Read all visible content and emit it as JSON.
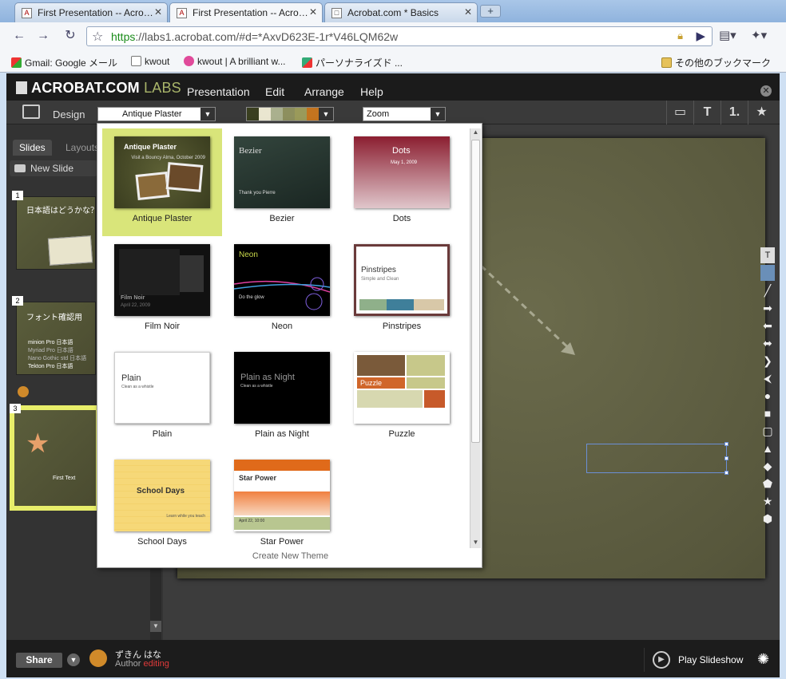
{
  "browser": {
    "tabs": [
      {
        "title": "First Presentation -- Acro…"
      },
      {
        "title": "First Presentation -- Acro…"
      },
      {
        "title": "Acrobat.com * Basics"
      }
    ],
    "url_scheme": "https",
    "url_rest": "://labs1.acrobat.com/#d=*AxvD623E-1r*V46LQM62w",
    "bookmarks": [
      {
        "label": "Gmail: Google メール"
      },
      {
        "label": "kwout"
      },
      {
        "label": "kwout | A brilliant w..."
      },
      {
        "label": "パーソナライズド ..."
      },
      {
        "label": "その他のブックマーク"
      }
    ]
  },
  "app": {
    "logo_main": "ACROBAT.COM",
    "logo_labs": "LABS",
    "menu": [
      "Presentation",
      "Edit",
      "Arrange",
      "Help"
    ],
    "design_label": "Design",
    "theme_select": "Antique Plaster",
    "zoom_select": "Zoom",
    "palette_colors": [
      "#3a3f20",
      "#eae6d0",
      "#aab08e",
      "#8d8f5e",
      "#9a9a5a",
      "#c3741f"
    ],
    "tools": [
      "T",
      "1."
    ]
  },
  "leftpanel": {
    "tabs": [
      "Slides",
      "Layouts"
    ],
    "new_slide": "New Slide",
    "slides": [
      {
        "num": "1",
        "title": "日本語はどうかな？"
      },
      {
        "num": "2",
        "title": "フォント確認用",
        "lines": [
          "minion Pro 日本語",
          "Myriad Pro 日本語",
          "Nano Gothic std 日本語",
          "Tekton Pro 日本語"
        ]
      },
      {
        "num": "3",
        "title": "First Text"
      }
    ]
  },
  "theme_panel": {
    "themes": [
      {
        "name": "Antique Plaster",
        "thumb_title": "Antique Plaster",
        "thumb_sub": "Visit a Bouncy Alma, October 2009"
      },
      {
        "name": "Bezier",
        "thumb_title": "Bezier",
        "thumb_sub": "Thank you Pierre"
      },
      {
        "name": "Dots",
        "thumb_title": "Dots",
        "thumb_sub": "May 1, 2009"
      },
      {
        "name": "Film Noir",
        "thumb_title": "Film Noir",
        "thumb_sub": "April 22, 2009"
      },
      {
        "name": "Neon",
        "thumb_title": "Neon",
        "thumb_sub": "Do the glow"
      },
      {
        "name": "Pinstripes",
        "thumb_title": "Pinstripes",
        "thumb_sub": "Simple and Clean"
      },
      {
        "name": "Plain",
        "thumb_title": "Plain",
        "thumb_sub": "Clean as a whistle"
      },
      {
        "name": "Plain as Night",
        "thumb_title": "Plain as Night",
        "thumb_sub": "Clean as a whistle"
      },
      {
        "name": "Puzzle",
        "thumb_title": "Puzzle",
        "thumb_sub": ""
      },
      {
        "name": "School Days",
        "thumb_title": "School Days",
        "thumb_sub": "Learn while you teach"
      },
      {
        "name": "Star Power",
        "thumb_title": "Star Power",
        "thumb_sub": "April 22, 10:00"
      }
    ],
    "selected": "Antique Plaster",
    "create_new": "Create New Theme"
  },
  "bottombar": {
    "share": "Share",
    "author_name": "ずきん はな",
    "author_label": "Author",
    "author_status": "editing",
    "play": "Play Slideshow"
  }
}
